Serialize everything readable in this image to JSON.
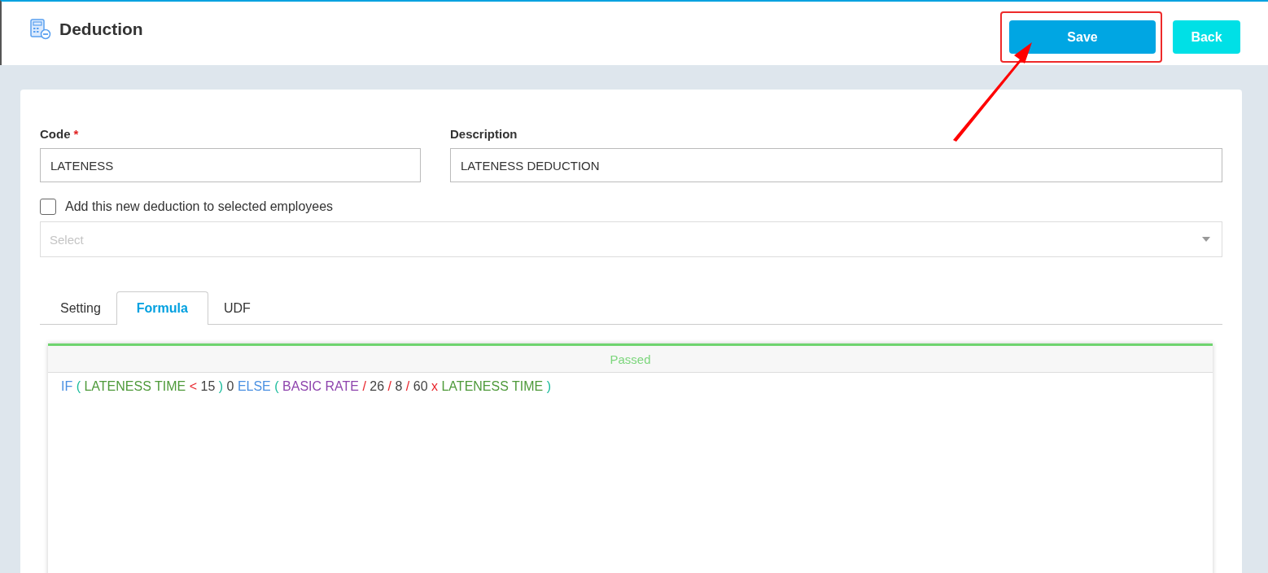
{
  "page": {
    "title": "Deduction"
  },
  "buttons": [
    {
      "label": "Save",
      "kind": "primary",
      "highlighted": true
    },
    {
      "label": "Back",
      "kind": "secondary",
      "highlighted": false
    }
  ],
  "form": {
    "code": {
      "label": "Code",
      "required_mark": "*",
      "value": "LATENESS"
    },
    "description": {
      "label": "Description",
      "value": "LATENESS DEDUCTION"
    },
    "add_to_employees": {
      "label": "Add this new deduction to selected employees",
      "checked": false
    },
    "employees_select": {
      "placeholder": "Select"
    }
  },
  "tabs": [
    {
      "label": "Setting",
      "selected": false
    },
    {
      "label": "Formula",
      "selected": true
    },
    {
      "label": "UDF",
      "selected": false
    }
  ],
  "formula": {
    "status": "Passed",
    "passed": true,
    "tokens": [
      {
        "text": "IF",
        "kind": "keyword"
      },
      {
        "text": "(",
        "kind": "paren"
      },
      {
        "text": "LATENESS TIME",
        "kind": "variable"
      },
      {
        "text": "<",
        "kind": "operator"
      },
      {
        "text": "15",
        "kind": "number"
      },
      {
        "text": ")",
        "kind": "paren"
      },
      {
        "text": "0",
        "kind": "number"
      },
      {
        "text": "ELSE",
        "kind": "keyword"
      },
      {
        "text": "(",
        "kind": "paren"
      },
      {
        "text": "BASIC RATE",
        "kind": "field"
      },
      {
        "text": "/",
        "kind": "operator"
      },
      {
        "text": "26",
        "kind": "number"
      },
      {
        "text": "/",
        "kind": "operator"
      },
      {
        "text": "8",
        "kind": "number"
      },
      {
        "text": "/",
        "kind": "operator"
      },
      {
        "text": "60",
        "kind": "number"
      },
      {
        "text": "x",
        "kind": "operator"
      },
      {
        "text": "LATENESS TIME",
        "kind": "variable"
      },
      {
        "text": ")",
        "kind": "paren"
      }
    ]
  }
}
